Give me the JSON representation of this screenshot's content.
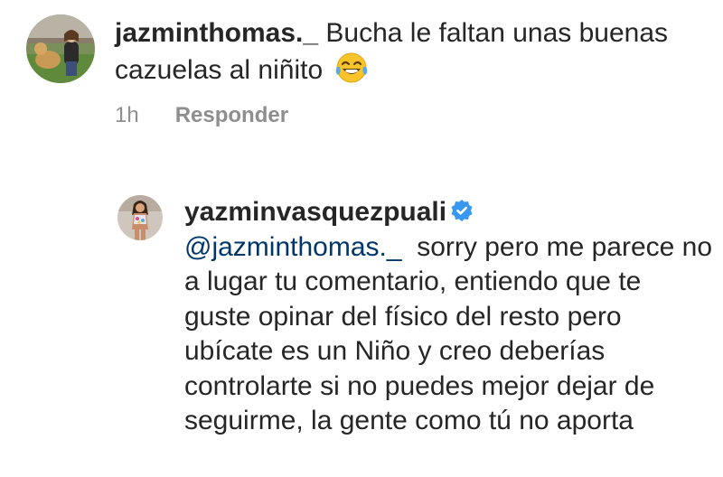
{
  "comment": {
    "username": "jazminthomas._",
    "text": "Bucha le faltan unas buenas cazuelas al niñito",
    "emoji": "tears-of-joy-emoji",
    "time": "1h",
    "reply_label": "Responder",
    "avatar": "user-photo-with-dog"
  },
  "reply": {
    "username": "yazminvasquezpuali",
    "verified": true,
    "verified_icon": "verified-badge-icon",
    "verified_color": "#3897f0",
    "mention": "@jazminthomas._",
    "text": "sorry pero me parece no a lugar tu comentario, entiendo que te guste opinar del físico del resto pero ubícate es un Niño y creo deberías controlarte si no puedes mejor dejar de seguirme, la gente como tú no aporta",
    "avatar": "user-photo"
  },
  "colors": {
    "text": "#262626",
    "secondary": "#8e8e8e",
    "mention": "#00376b",
    "background": "#ffffff"
  }
}
